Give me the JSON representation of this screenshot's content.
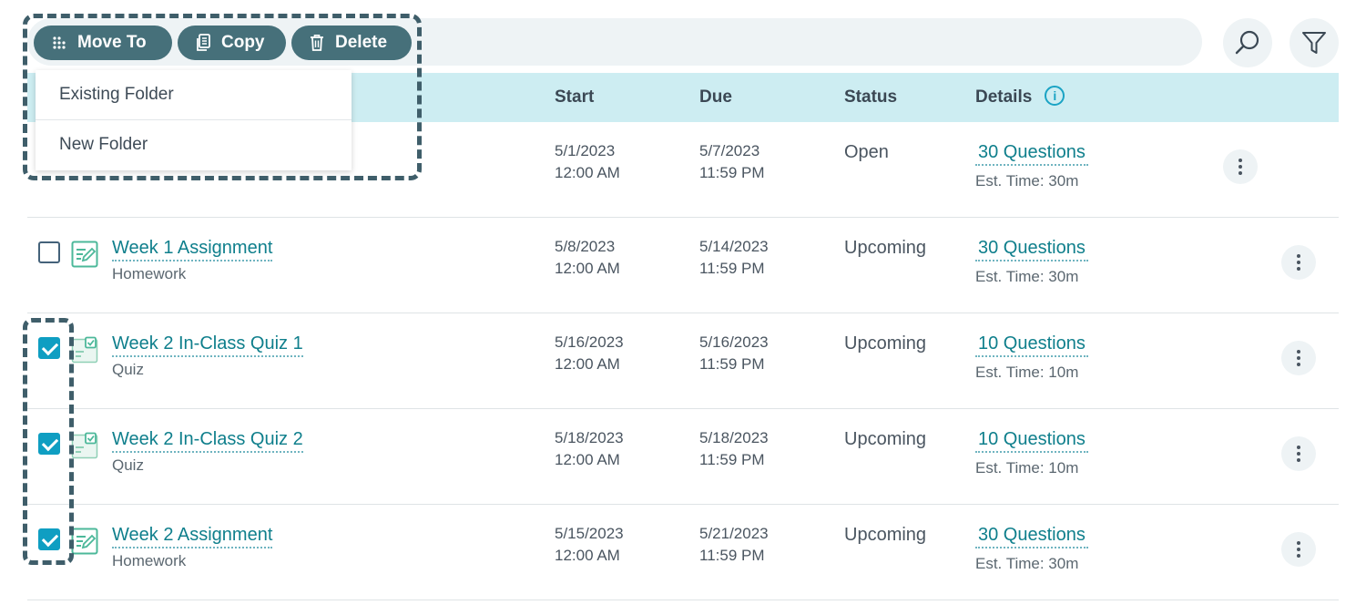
{
  "toolbar": {
    "move_label": "Move To",
    "copy_label": "Copy",
    "delete_label": "Delete"
  },
  "dropdown": {
    "items": [
      "Existing Folder",
      "New Folder"
    ]
  },
  "table": {
    "headers": {
      "start": "Start",
      "due": "Due",
      "status": "Status",
      "details": "Details"
    },
    "rows": [
      {
        "title": "",
        "type": "",
        "start_date": "5/1/2023",
        "start_time": "12:00 AM",
        "due_date": "5/7/2023",
        "due_time": "11:59 PM",
        "status": "Open",
        "questions": "30 Questions",
        "est_time": "Est. Time: 30m",
        "checked": false
      },
      {
        "title": "Week 1 Assignment",
        "type": "Homework",
        "start_date": "5/8/2023",
        "start_time": "12:00 AM",
        "due_date": "5/14/2023",
        "due_time": "11:59 PM",
        "status": "Upcoming",
        "questions": "30 Questions",
        "est_time": "Est. Time: 30m",
        "checked": false
      },
      {
        "title": "Week 2 In-Class Quiz 1",
        "type": "Quiz",
        "start_date": "5/16/2023",
        "start_time": "12:00 AM",
        "due_date": "5/16/2023",
        "due_time": "11:59 PM",
        "status": "Upcoming",
        "questions": "10 Questions",
        "est_time": "Est. Time: 10m",
        "checked": true
      },
      {
        "title": "Week 2 In-Class Quiz 2",
        "type": "Quiz",
        "start_date": "5/18/2023",
        "start_time": "12:00 AM",
        "due_date": "5/18/2023",
        "due_time": "11:59 PM",
        "status": "Upcoming",
        "questions": "10 Questions",
        "est_time": "Est. Time: 10m",
        "checked": true
      },
      {
        "title": "Week 2 Assignment",
        "type": "Homework",
        "start_date": "5/15/2023",
        "start_time": "12:00 AM",
        "due_date": "5/21/2023",
        "due_time": "11:59 PM",
        "status": "Upcoming",
        "questions": "30 Questions",
        "est_time": "Est. Time: 30m",
        "checked": true
      }
    ]
  },
  "icons": {
    "move": "drag-dots-icon",
    "copy": "copy-icon",
    "delete": "trash-icon",
    "search": "search-icon",
    "filter": "filter-icon",
    "info": "info-icon",
    "homework": "homework-icon",
    "quiz": "quiz-icon",
    "more": "more-vertical-icon"
  },
  "colors": {
    "toolbar_button": "#46707a",
    "header_bg": "#cdedf2",
    "link": "#0f7f8c",
    "checkbox_checked": "#0f9ec2",
    "dashed_outline": "#3f5e6a"
  }
}
